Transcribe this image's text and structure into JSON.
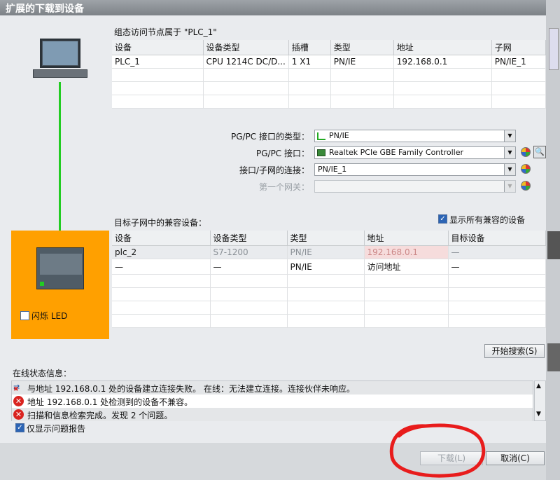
{
  "dialog": {
    "title": "扩展的下载到设备"
  },
  "config_section": {
    "heading": "组态访问节点属于 \"PLC_1\"",
    "columns": [
      "设备",
      "设备类型",
      "插槽",
      "类型",
      "地址",
      "子网"
    ],
    "rows": [
      [
        "PLC_1",
        "CPU 1214C DC/D...",
        "1 X1",
        "PN/IE",
        "192.168.0.1",
        "PN/IE_1"
      ]
    ]
  },
  "interface": {
    "pgpc_type_label": "PG/PC 接口的类型：",
    "pgpc_type_value": "PN/IE",
    "pgpc_iface_label": "PG/PC 接口：",
    "pgpc_iface_value": "Realtek PCIe GBE Family Controller",
    "subnet_label": "接口/子网的连接：",
    "subnet_value": "PN/IE_1",
    "gateway_label": "第一个网关：",
    "gateway_value": ""
  },
  "target_section": {
    "heading": "目标子网中的兼容设备：",
    "show_all_label": "显示所有兼容的设备",
    "show_all_checked": true,
    "columns": [
      "设备",
      "设备类型",
      "类型",
      "地址",
      "目标设备"
    ],
    "rows": [
      [
        "plc_2",
        "S7-1200",
        "PN/IE",
        "192.168.0.1",
        "—"
      ],
      [
        "—",
        "—",
        "PN/IE",
        "访问地址",
        "—"
      ]
    ],
    "search_button": "开始搜索(S)"
  },
  "flash_led_label": "闪烁 LED",
  "status": {
    "heading": "在线状态信息：",
    "messages": [
      {
        "icon": "connection-error-icon",
        "text": "与地址 192.168.0.1 处的设备建立连接失败。 在线：无法建立连接。连接伙伴未响应。"
      },
      {
        "icon": "error-icon",
        "text": "地址 192.168.0.1 处检测到的设备不兼容。"
      },
      {
        "icon": "error-icon",
        "text": "扫描和信息检索完成。发现 2 个问题。"
      }
    ],
    "only_problems_label": "仅显示问题报告",
    "only_problems_checked": true
  },
  "buttons": {
    "download": "下载(L)",
    "cancel": "取消(C)"
  },
  "colors": {
    "orange_panel": "#ffa000",
    "link_line": "#22cc22",
    "annotation_circle": "#e81c1c"
  }
}
